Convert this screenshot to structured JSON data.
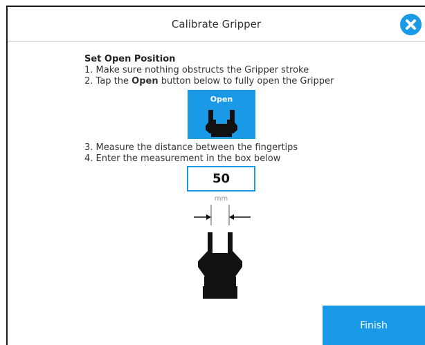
{
  "dialog": {
    "title": "Calibrate Gripper",
    "close_icon": "close-x-icon"
  },
  "instructions": {
    "heading": "Set Open Position",
    "step1": "1. Make sure nothing obstructs the Gripper stroke",
    "step2_prefix": "2. Tap the ",
    "step2_bold": "Open",
    "step2_suffix": " button below to fully open the Gripper",
    "step3": "3. Measure the distance between the fingertips",
    "step4": "4. Enter the measurement in the box below"
  },
  "open_button": {
    "label": "Open",
    "icon": "gripper-open-icon"
  },
  "measurement": {
    "value": "50",
    "unit": "mm"
  },
  "finish_button": {
    "label": "Finish"
  },
  "colors": {
    "accent": "#1a9ae6",
    "text": "#333333",
    "divider": "#bdbdbd"
  }
}
